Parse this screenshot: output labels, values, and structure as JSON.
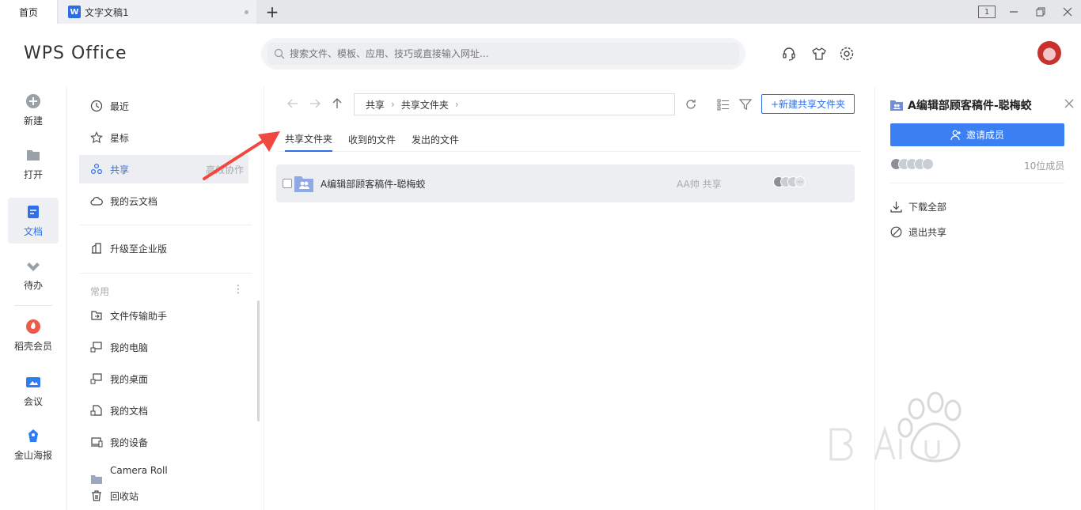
{
  "tabs": {
    "home": "首页",
    "doc_icon": "W",
    "doc": "文字文稿1",
    "add": "+"
  },
  "window": {
    "layout_badge": "1"
  },
  "header": {
    "logo": "WPS Office",
    "search_placeholder": "搜索文件、模板、应用、技巧或直接输入网址..."
  },
  "rail": [
    {
      "label": "新建",
      "icon": "plus-circle-icon"
    },
    {
      "label": "打开",
      "icon": "folder-icon"
    },
    {
      "label": "文档",
      "icon": "document-icon"
    },
    {
      "label": "待办",
      "icon": "check-icon"
    },
    {
      "label": "稻壳会员",
      "icon": "flame-icon"
    },
    {
      "label": "会议",
      "icon": "video-camera-icon"
    },
    {
      "label": "金山海报",
      "icon": "poster-icon"
    }
  ],
  "menu": {
    "recent": "最近",
    "starred": "星标",
    "shared": "共享",
    "shared_aside": "高效协作",
    "cloud": "我的云文档",
    "upgrade": "升级至企业版",
    "group_label": "常用",
    "group_more": "⋮",
    "transfer": "文件传输助手",
    "pc": "我的电脑",
    "desktop": "我的桌面",
    "docs": "我的文档",
    "devices": "我的设备",
    "camera_roll": "Camera Roll",
    "trash": "回收站"
  },
  "main": {
    "breadcrumb": [
      "共享",
      "共享文件夹"
    ],
    "new_share_folder": "+新建共享文件夹",
    "tabs": [
      "共享文件夹",
      "收到的文件",
      "发出的文件"
    ],
    "files": [
      {
        "name": "A编辑部顾客稿件-聪梅蛟",
        "owner": "AA帅 共享",
        "avatars_more": "···"
      }
    ]
  },
  "panel": {
    "title": "A编辑部顾客稿件-聪梅蛟",
    "invite": "邀请成员",
    "member_count": "10位成员",
    "download_all": "下载全部",
    "exit_share": "退出共享"
  },
  "colors": {
    "accent": "#2f6fea",
    "button": "#3b7ff2",
    "annotation_arrow": "#f2473f"
  }
}
